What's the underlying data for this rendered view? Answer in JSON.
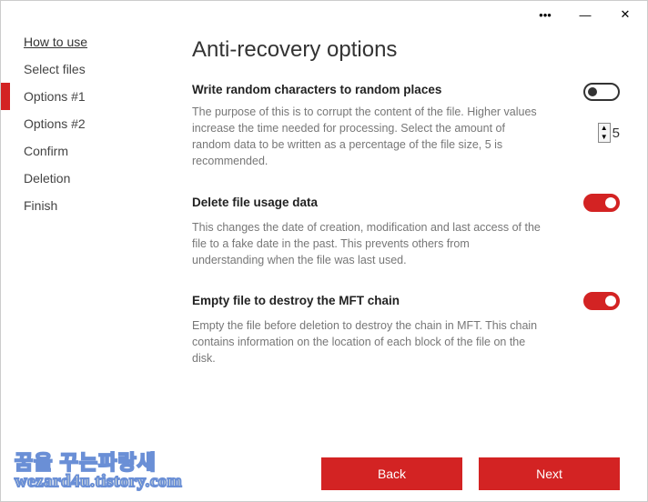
{
  "titlebar": {
    "more": "•••",
    "minimize": "—",
    "close": "✕"
  },
  "sidebar": {
    "items": [
      {
        "label": "How to use"
      },
      {
        "label": "Select files"
      },
      {
        "label": "Options #1"
      },
      {
        "label": "Options #2"
      },
      {
        "label": "Confirm"
      },
      {
        "label": "Deletion"
      },
      {
        "label": "Finish"
      }
    ]
  },
  "main": {
    "title": "Anti-recovery options",
    "options": [
      {
        "title": "Write random characters to random places",
        "desc": "The purpose of this is to corrupt the content of the file. Higher values increase the time needed for processing. Select the amount of random data to be written as a percentage of the file size, 5 is recommended.",
        "toggle": false,
        "spinner_value": "5"
      },
      {
        "title": "Delete file usage data",
        "desc": "This changes the date of creation, modification and last access of the file to a fake date in the past. This prevents others from understanding when the file was last used.",
        "toggle": true
      },
      {
        "title": "Empty file to destroy the MFT chain",
        "desc": "Empty the file before deletion to destroy the chain in MFT. This chain contains information on the location of each block of the file on the disk.",
        "toggle": true
      }
    ]
  },
  "buttons": {
    "back": "Back",
    "next": "Next"
  },
  "watermark": {
    "line1": "꿈을 꾸는파랑새",
    "line2": "wezard4u.tistory.com"
  }
}
